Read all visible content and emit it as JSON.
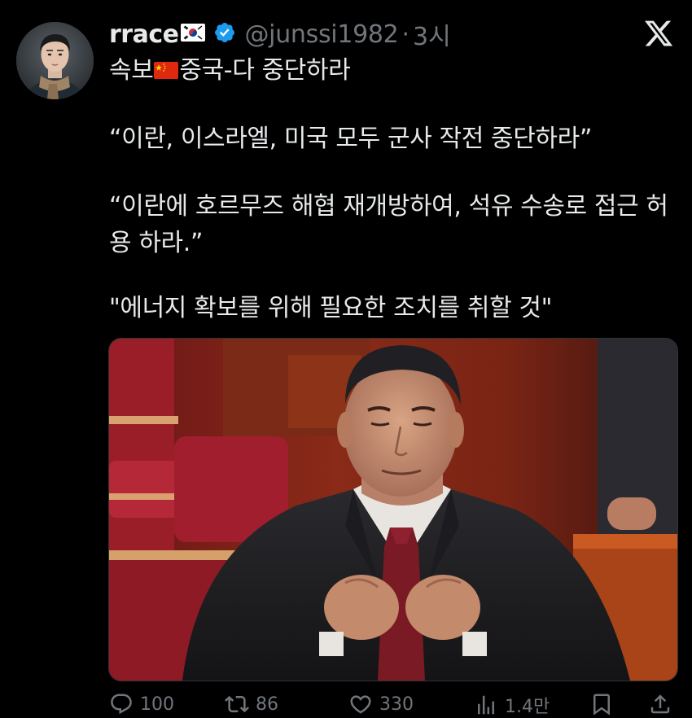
{
  "tweet": {
    "display_name": "rrace",
    "handle": "@junssi1982",
    "separator": "·",
    "time": "3시",
    "lines": [
      "속보",
      "중국-다 중단하라",
      "“이란, 이스라엘, 미국 모두 군사 작전 중단하라”",
      "“이란에 호르무즈 해협 재개방하여, 석유 수송로 접근 허",
      "용 하라.”",
      "\"에너지 확보를 위해 필요한 조치를 취할 것\""
    ]
  },
  "actions": {
    "replies": "100",
    "reposts": "86",
    "likes": "330",
    "views": "1.4만"
  },
  "icons": {
    "verified": "verified-badge-icon",
    "x_logo": "x-logo-icon",
    "flag_kr": "south-korea-flag-icon",
    "flag_cn": "china-flag-icon"
  },
  "colors": {
    "background": "#000000",
    "text": "#e7e9ea",
    "muted": "#71767b",
    "verified": "#1d9bf0"
  }
}
